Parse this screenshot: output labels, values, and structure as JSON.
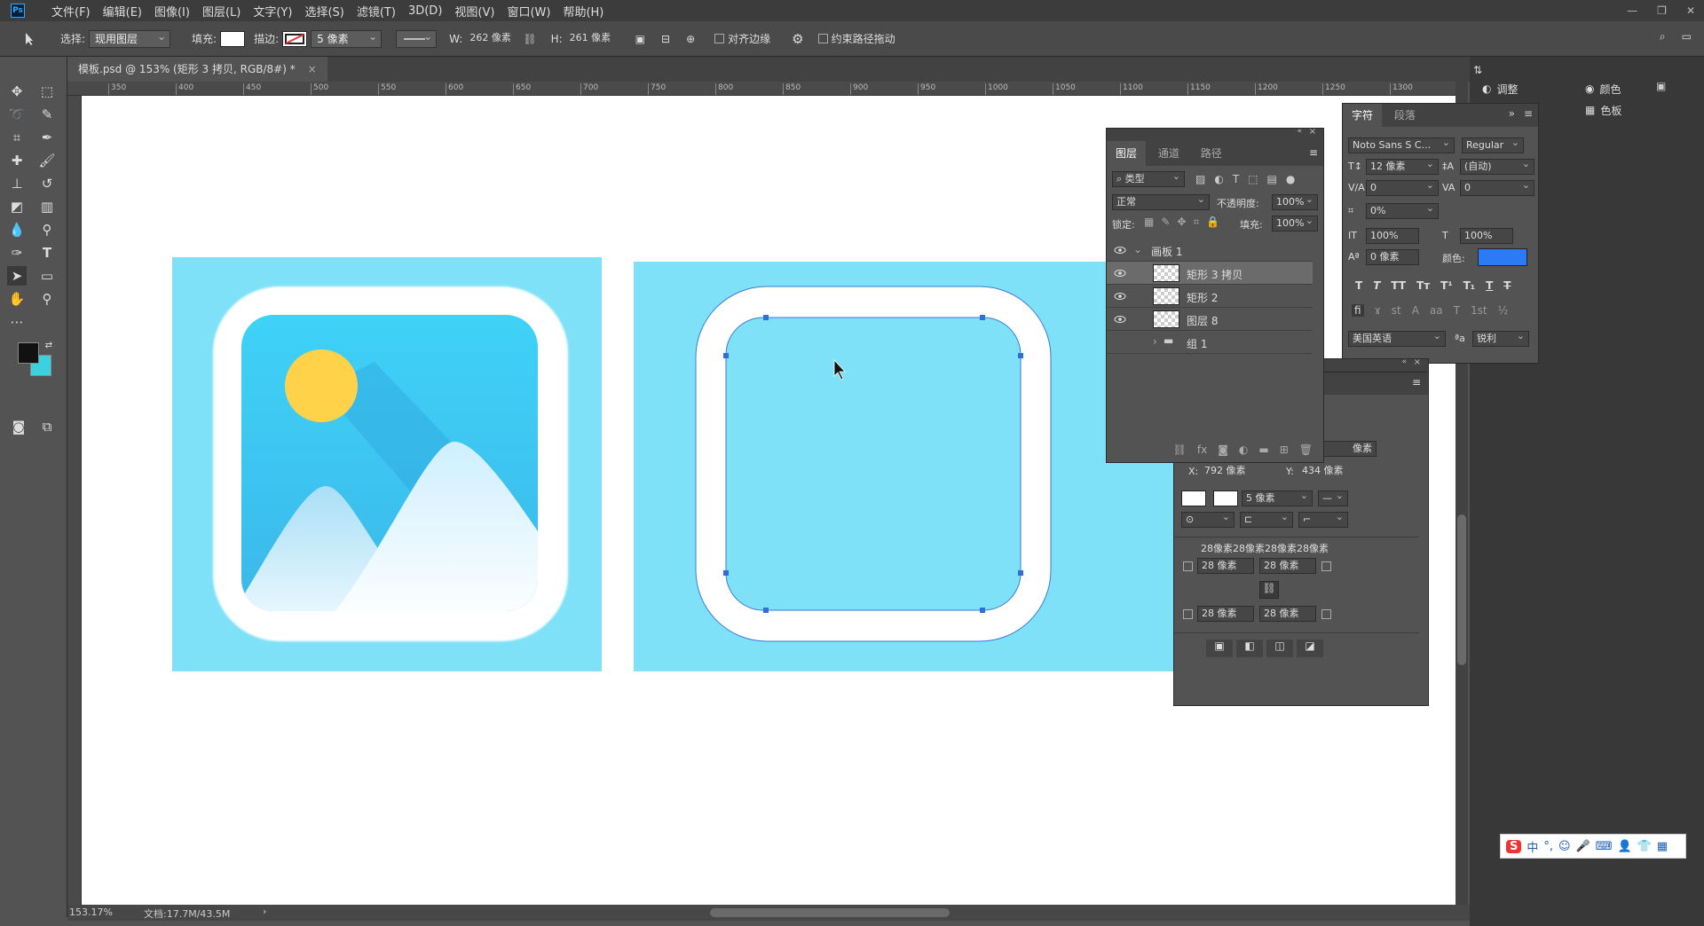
{
  "menu": {
    "logo": "Ps",
    "items": [
      "文件(F)",
      "编辑(E)",
      "图像(I)",
      "图层(L)",
      "文字(Y)",
      "选择(S)",
      "滤镜(T)",
      "3D(D)",
      "视图(V)",
      "窗口(W)",
      "帮助(H)"
    ]
  },
  "options": {
    "select_label": "选择:",
    "select_value": "现用图层",
    "fill_label": "填充:",
    "stroke_label": "描边:",
    "stroke_size": "5 像素",
    "w_label": "W:",
    "w_value": "262 像素",
    "h_label": "H:",
    "h_value": "261 像素",
    "align_edges": "对齐边缘",
    "constrain_path": "约束路径拖动"
  },
  "document": {
    "tab_title": "模板.psd @ 153% (矩形 3 拷贝, RGB/8#) *",
    "zoom": "153.17%",
    "doc_size": "文档:17.7M/43.5M",
    "ruler_ticks": [
      "350",
      "400",
      "450",
      "500",
      "550",
      "600",
      "650",
      "700",
      "750",
      "800",
      "850",
      "900",
      "950",
      "1000",
      "1050",
      "1100",
      "1150",
      "1200",
      "1250",
      "1300"
    ]
  },
  "layers_panel": {
    "tabs": [
      "图层",
      "通道",
      "路径"
    ],
    "filter": "类型",
    "blend": "正常",
    "opacity_label": "不透明度:",
    "opacity": "100%",
    "lock_label": "锁定:",
    "fill_label": "填充:",
    "fill": "100%",
    "layers": [
      {
        "name": "画板 1",
        "type": "artboard"
      },
      {
        "name": "矩形 3 拷贝",
        "selected": true
      },
      {
        "name": "矩形 2"
      },
      {
        "name": "图层 8"
      },
      {
        "name": "组 1",
        "type": "group"
      }
    ]
  },
  "properties_panel": {
    "x_label": "X:",
    "x": "792 像素",
    "y_label": "Y:",
    "y": "434 像素",
    "stroke": "5 像素",
    "px_partial": "像素",
    "corners_summary": "28像素28像素28像素28像素",
    "c1": "28 像素",
    "c2": "28 像素",
    "c3": "28 像素",
    "c4": "28 像素"
  },
  "character_panel": {
    "tabs": [
      "字符",
      "段落"
    ],
    "font": "Noto Sans S C...",
    "style": "Regular",
    "size": "12 像素",
    "leading": "(自动)",
    "kerning": "0",
    "tracking": "0",
    "scale_pct": "0%",
    "vscale": "100%",
    "hscale": "100%",
    "baseline": "0 像素",
    "color_label": "颜色:",
    "language": "美国英语",
    "aa_label": "ªa",
    "aa": "锐利",
    "color": "#2b7bf7"
  },
  "right_dock": {
    "adjust": "调整",
    "color": "颜色",
    "swatches": "色板"
  },
  "colors": {
    "sky": "#7fe1f7",
    "fg": "#111111",
    "bg": "#3ad1e0",
    "accent": "#2b7bf7"
  }
}
